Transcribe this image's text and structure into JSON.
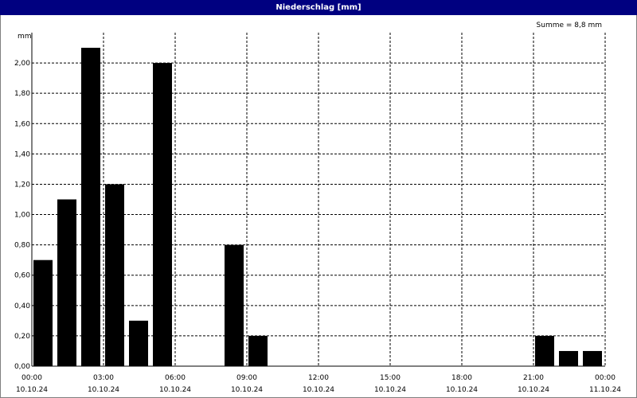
{
  "window": {
    "title": "Niederschlag [mm]"
  },
  "chart_data": {
    "type": "bar",
    "title": "Niederschlag [mm]",
    "ylabel": "mm",
    "annotation": "Summe = 8,8 mm",
    "ylim": [
      0,
      2.2
    ],
    "y_ticks": [
      "0,00",
      "0,20",
      "0,40",
      "0,60",
      "0,80",
      "1,00",
      "1,20",
      "1,40",
      "1,60",
      "1,80",
      "2,00"
    ],
    "x_ticks": [
      {
        "time": "00:00",
        "date": "10.10.24"
      },
      {
        "time": "03:00",
        "date": "10.10.24"
      },
      {
        "time": "06:00",
        "date": "10.10.24"
      },
      {
        "time": "09:00",
        "date": "10.10.24"
      },
      {
        "time": "12:00",
        "date": "10.10.24"
      },
      {
        "time": "15:00",
        "date": "10.10.24"
      },
      {
        "time": "18:00",
        "date": "10.10.24"
      },
      {
        "time": "21:00",
        "date": "10.10.24"
      },
      {
        "time": "00:00",
        "date": "11.10.24"
      }
    ],
    "x_range_hours": [
      0,
      24
    ],
    "grid": true,
    "bar_color": "#000000",
    "bars": [
      {
        "hour": 0,
        "value": 0.7
      },
      {
        "hour": 1,
        "value": 1.1
      },
      {
        "hour": 2,
        "value": 2.1
      },
      {
        "hour": 3,
        "value": 1.2
      },
      {
        "hour": 4,
        "value": 0.3
      },
      {
        "hour": 5,
        "value": 2.0
      },
      {
        "hour": 6,
        "value": 0.0
      },
      {
        "hour": 7,
        "value": 0.0
      },
      {
        "hour": 8,
        "value": 0.8
      },
      {
        "hour": 9,
        "value": 0.2
      },
      {
        "hour": 10,
        "value": 0.0
      },
      {
        "hour": 11,
        "value": 0.0
      },
      {
        "hour": 12,
        "value": 0.0
      },
      {
        "hour": 13,
        "value": 0.0
      },
      {
        "hour": 14,
        "value": 0.0
      },
      {
        "hour": 15,
        "value": 0.0
      },
      {
        "hour": 16,
        "value": 0.0
      },
      {
        "hour": 17,
        "value": 0.0
      },
      {
        "hour": 18,
        "value": 0.0
      },
      {
        "hour": 19,
        "value": 0.0
      },
      {
        "hour": 20,
        "value": 0.0
      },
      {
        "hour": 21,
        "value": 0.2
      },
      {
        "hour": 22,
        "value": 0.1
      },
      {
        "hour": 23,
        "value": 0.1
      }
    ]
  }
}
